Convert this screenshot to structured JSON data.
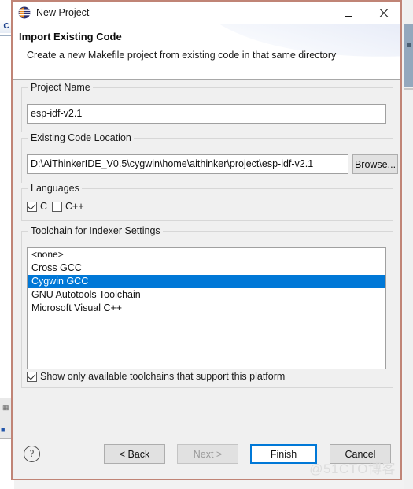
{
  "window": {
    "title": "New Project",
    "icon": "eclipse-circle-icon",
    "controls": {
      "minimize": "minimize-icon",
      "maximize": "maximize-icon",
      "close": "close-icon"
    },
    "border_color": "#c08476"
  },
  "header": {
    "title": "Import Existing Code",
    "description": "Create a new Makefile project from existing code in that same directory"
  },
  "project_name_group": {
    "legend": "Project Name",
    "value": "esp-idf-v2.1",
    "placeholder": ""
  },
  "existing_code_group": {
    "legend": "Existing Code Location",
    "value": "D:\\AiThinkerIDE_V0.5\\cygwin\\home\\aithinker\\project\\esp-idf-v2.1",
    "placeholder": "",
    "browse_label": "Browse..."
  },
  "languages_group": {
    "legend": "Languages",
    "options": [
      {
        "label": "C",
        "checked": true
      },
      {
        "label": "C++",
        "checked": false
      }
    ]
  },
  "toolchain_group": {
    "legend": "Toolchain for Indexer Settings",
    "items": [
      {
        "label": "<none>",
        "selected": false
      },
      {
        "label": "Cross GCC",
        "selected": false
      },
      {
        "label": "Cygwin GCC",
        "selected": true
      },
      {
        "label": "GNU Autotools Toolchain",
        "selected": false
      },
      {
        "label": "Microsoft Visual C++",
        "selected": false
      }
    ],
    "selected_value": "Cygwin GCC",
    "selection_color": "#0078d7",
    "filter_checkbox": {
      "label": "Show only available toolchains that support this platform",
      "checked": true
    }
  },
  "footer": {
    "help_glyph": "?",
    "buttons": [
      {
        "name": "back",
        "label": "< Back",
        "state": "enabled"
      },
      {
        "name": "next",
        "label": "Next >",
        "state": "disabled"
      },
      {
        "name": "finish",
        "label": "Finish",
        "state": "default"
      },
      {
        "name": "cancel",
        "label": "Cancel",
        "state": "enabled"
      }
    ]
  },
  "watermark": {
    "text": "@51CTO博客"
  },
  "background": {
    "tab_label": "C"
  }
}
